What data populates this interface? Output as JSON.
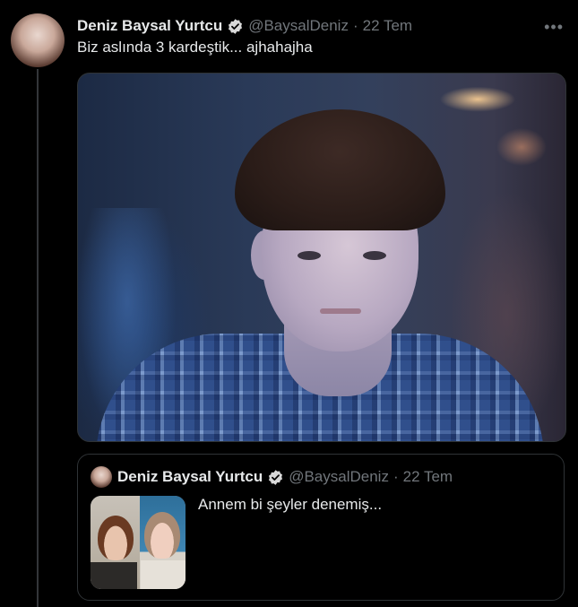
{
  "tweet": {
    "author_name": "Deniz Baysal Yurtcu",
    "handle": "@BaysalDeniz",
    "separator": "·",
    "date": "22 Tem",
    "more_label": "•••",
    "text": "Biz aslında 3 kardeştik... ajhahajha",
    "verified_icon": "verified-badge-icon"
  },
  "quoted_tweet": {
    "author_name": "Deniz Baysal Yurtcu",
    "handle": "@BaysalDeniz",
    "separator": "·",
    "date": "22 Tem",
    "text": "Annem bi şeyler denemiş..."
  },
  "colors": {
    "background": "#000000",
    "text": "#e7e9ea",
    "muted": "#71767b",
    "border": "#2f3336",
    "verified": "#d9d9d9"
  }
}
